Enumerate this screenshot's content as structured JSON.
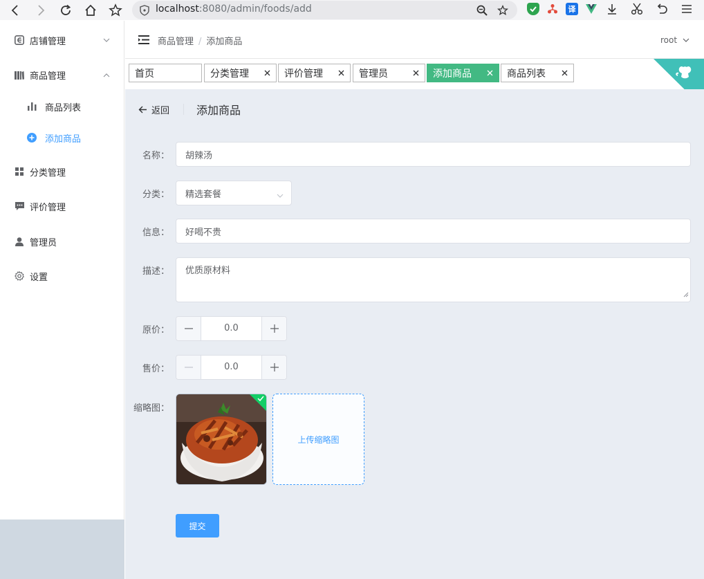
{
  "browser": {
    "url_host": "localhost",
    "url_rest": ":8080/admin/foods/add"
  },
  "sidebar": {
    "items": [
      {
        "label": "店铺管理"
      },
      {
        "label": "商品管理"
      },
      {
        "label": "商品列表"
      },
      {
        "label": "添加商品"
      },
      {
        "label": "分类管理"
      },
      {
        "label": "评价管理"
      },
      {
        "label": "管理员"
      },
      {
        "label": "设置"
      }
    ]
  },
  "header": {
    "breadcrumb": [
      "商品管理",
      "添加商品"
    ],
    "user": "root"
  },
  "tags": [
    {
      "label": "首页",
      "closable": false
    },
    {
      "label": "分类管理",
      "closable": true
    },
    {
      "label": "评价管理",
      "closable": true
    },
    {
      "label": "管理员",
      "closable": true
    },
    {
      "label": "添加商品",
      "closable": true,
      "active": true
    },
    {
      "label": "商品列表",
      "closable": true
    }
  ],
  "page": {
    "back_label": "返回",
    "title": "添加商品"
  },
  "form": {
    "name_label": "名称：",
    "name_value": "胡辣汤",
    "category_label": "分类：",
    "category_value": "精选套餐",
    "info_label": "信息：",
    "info_value": "好喝不贵",
    "desc_label": "描述：",
    "desc_value": "优质原材料",
    "orig_price_label": "原价：",
    "orig_price_value": "0.0",
    "price_label": "售价：",
    "price_value": "0.0",
    "thumb_label": "缩略图：",
    "upload_label": "上传缩略图",
    "submit_label": "提交"
  },
  "colors": {
    "accent": "#409eff",
    "tag_active": "#42b983",
    "corner": "#40c0b8",
    "main_bg": "#e9edf3"
  }
}
